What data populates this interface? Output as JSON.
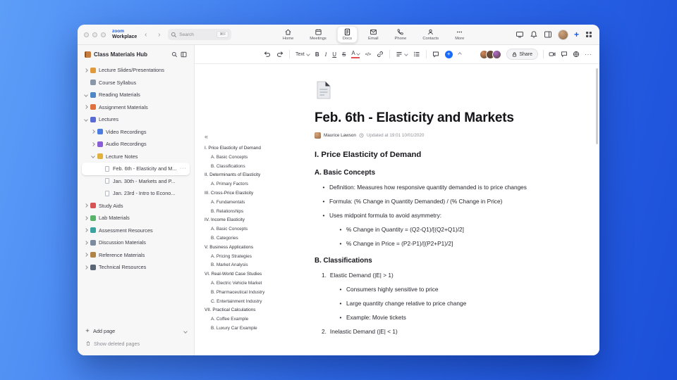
{
  "colors": {
    "accent": "#0b5cff",
    "bg_start": "#5d9ef8",
    "bg_end": "#1b4fd9",
    "insert_blue": "#176bff"
  },
  "chrome": {
    "brand_top": "zoom",
    "brand_bottom": "Workplace",
    "back": "‹",
    "forward": "›",
    "search": {
      "placeholder": "Search",
      "shortcut": "⌘F"
    },
    "tabs": [
      {
        "label": "Home",
        "icon": "home",
        "active": false
      },
      {
        "label": "Meetings",
        "icon": "calendar",
        "active": false
      },
      {
        "label": "Docs",
        "icon": "doc",
        "active": true
      },
      {
        "label": "Email",
        "icon": "mail",
        "active": false
      },
      {
        "label": "Phone",
        "icon": "phone",
        "active": false
      },
      {
        "label": "Contacts",
        "icon": "contacts",
        "active": false
      },
      {
        "label": "More",
        "icon": "more",
        "active": false
      }
    ],
    "plus_label": "+"
  },
  "sidebar": {
    "title": "Class Materials Hub",
    "items": [
      {
        "label": "Lecture Slides/Presentations",
        "level": 0,
        "chevron": "right",
        "icon": "slides",
        "color": "#e09a3c"
      },
      {
        "label": "Course Syllabus",
        "level": 0,
        "chevron": "none",
        "icon": "syllabus",
        "color": "#8a97a8"
      },
      {
        "label": "Reading Materials",
        "level": 0,
        "chevron": "down",
        "icon": "book",
        "color": "#4f86c6"
      },
      {
        "label": "Assignment Materials",
        "level": 0,
        "chevron": "right",
        "icon": "pencil",
        "color": "#e0713c"
      },
      {
        "label": "Lectures",
        "level": 0,
        "chevron": "down",
        "icon": "lectures",
        "color": "#5b6bd6"
      },
      {
        "label": "Video Recordings",
        "level": 1,
        "chevron": "right",
        "icon": "video",
        "color": "#4a7de0"
      },
      {
        "label": "Audio Recordings",
        "level": 1,
        "chevron": "right",
        "icon": "audio",
        "color": "#8a5cd6"
      },
      {
        "label": "Lecture Notes",
        "level": 1,
        "chevron": "down",
        "icon": "notes",
        "color": "#e0b23c"
      },
      {
        "label": "Feb. 6th - Elasticity and M...",
        "level": 2,
        "chevron": "none",
        "icon": "page",
        "selected": true
      },
      {
        "label": "Jan. 30th - Markets and P...",
        "level": 2,
        "chevron": "none",
        "icon": "page"
      },
      {
        "label": "Jan. 23rd - Intro to Econo...",
        "level": 2,
        "chevron": "none",
        "icon": "page"
      },
      {
        "label": "Study Aids",
        "level": 0,
        "chevron": "right",
        "icon": "studybook",
        "color": "#d65454"
      },
      {
        "label": "Lab Materials",
        "level": 0,
        "chevron": "right",
        "icon": "lab",
        "color": "#57b36a"
      },
      {
        "label": "Assessment Resources",
        "level": 0,
        "chevron": "right",
        "icon": "assessment",
        "color": "#3aa3a0"
      },
      {
        "label": "Discussion Materials",
        "level": 0,
        "chevron": "right",
        "icon": "discussion",
        "color": "#7d8b9e"
      },
      {
        "label": "Reference Materials",
        "level": 0,
        "chevron": "right",
        "icon": "reference",
        "color": "#b08449"
      },
      {
        "label": "Technical Resources",
        "level": 0,
        "chevron": "right",
        "icon": "technical",
        "color": "#5a6676"
      }
    ],
    "add_page_label": "Add page",
    "show_deleted_label": "Show deleted pages"
  },
  "toolbar": {
    "text_style_label": "Text",
    "bold": "B",
    "italic": "I",
    "underline": "U",
    "strike": "S",
    "color_letter": "A",
    "code_label": "</>",
    "share_label": "Share",
    "more_dots": "···",
    "collaborators": [
      {
        "color": "#d98a5c"
      },
      {
        "color": "#6e4f3a"
      },
      {
        "color": "#b06ad0"
      }
    ]
  },
  "outline": {
    "collapse_icon": "«",
    "items": [
      {
        "label": "I. Price Elasticity of Demand",
        "level": 0
      },
      {
        "label": "A. Basic Concepts",
        "level": 1
      },
      {
        "label": "B. Classifications",
        "level": 1
      },
      {
        "label": "II. Determinants of Elasticity",
        "level": 0
      },
      {
        "label": "A. Primary Factors",
        "level": 1
      },
      {
        "label": "III. Cross-Price Elasticity",
        "level": 0
      },
      {
        "label": "A. Fundamentals",
        "level": 1
      },
      {
        "label": "B. Relationships",
        "level": 1
      },
      {
        "label": "IV. Income Elasticity",
        "level": 0
      },
      {
        "label": "A. Basic Concepts",
        "level": 1
      },
      {
        "label": "B. Categories",
        "level": 1
      },
      {
        "label": "V. Business Applications",
        "level": 0
      },
      {
        "label": "A. Pricing Strategies",
        "level": 1
      },
      {
        "label": "B. Market Analysis",
        "level": 1
      },
      {
        "label": "VI. Real-World Case Studies",
        "level": 0
      },
      {
        "label": "A. Electric Vehicle Market",
        "level": 1
      },
      {
        "label": "B. Pharmaceutical Industry",
        "level": 1
      },
      {
        "label": "C. Entertainment Industry",
        "level": 1
      },
      {
        "label": "VII. Practical Calculations",
        "level": 0
      },
      {
        "label": "A. Coffee Example",
        "level": 1
      },
      {
        "label": "B. Luxury Car Example",
        "level": 1
      }
    ]
  },
  "document": {
    "title": "Feb. 6th - Elasticity and Markets",
    "author": "Maurice Lawson",
    "updated": "Updated at 19:01 10/01/2020",
    "blocks": [
      {
        "type": "h2",
        "text": "I. Price Elasticity of Demand"
      },
      {
        "type": "h3",
        "text": "A. Basic Concepts"
      },
      {
        "type": "bullet",
        "level": 0,
        "text": "Definition: Measures how responsive quantity demanded is to price changes"
      },
      {
        "type": "bullet",
        "level": 0,
        "text": "Formula: (% Change in Quantity Demanded) / (% Change in Price)"
      },
      {
        "type": "bullet",
        "level": 0,
        "text": "Uses midpoint formula to avoid asymmetry:"
      },
      {
        "type": "bullet",
        "level": 1,
        "text": "% Change in Quantity = (Q2-Q1)/[(Q2+Q1)/2]"
      },
      {
        "type": "bullet",
        "level": 1,
        "text": "% Change in Price = (P2-P1)/[(P2+P1)/2]"
      },
      {
        "type": "h3",
        "text": "B. Classifications"
      },
      {
        "type": "number",
        "level": 0,
        "marker": "1.",
        "text": "Elastic Demand (|E| > 1)"
      },
      {
        "type": "bullet",
        "level": 1,
        "text": "Consumers highly sensitive to price"
      },
      {
        "type": "bullet",
        "level": 1,
        "text": "Large quantity change relative to price change"
      },
      {
        "type": "bullet",
        "level": 1,
        "text": "Example: Movie tickets"
      },
      {
        "type": "number",
        "level": 0,
        "marker": "2.",
        "text": "Inelastic Demand (|E| < 1)"
      }
    ]
  }
}
